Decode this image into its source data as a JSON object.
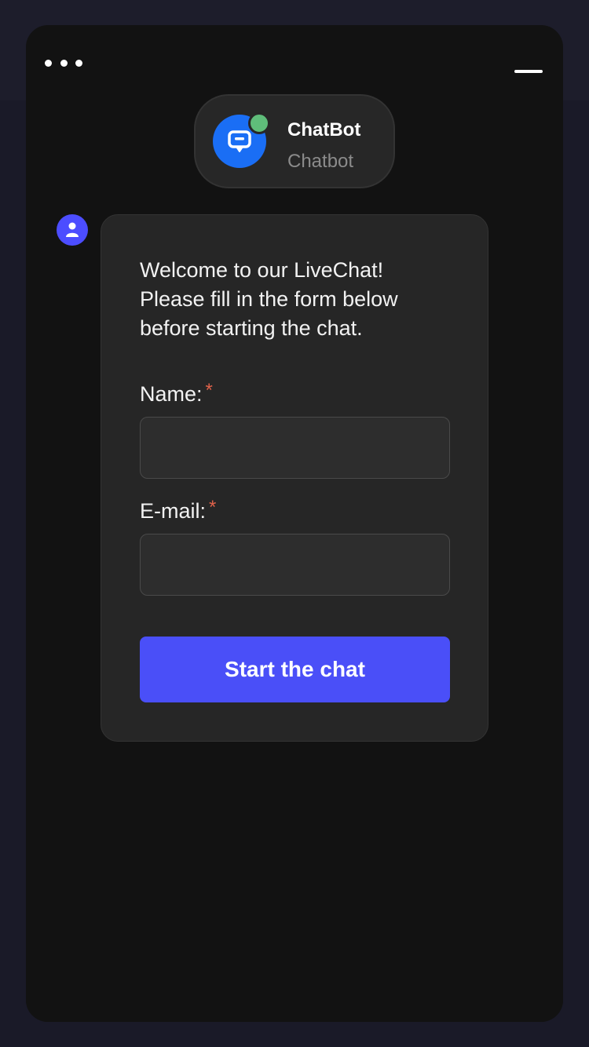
{
  "header": {
    "bot_name": "ChatBot",
    "bot_subtitle": "Chatbot",
    "status": "online",
    "status_color": "#5fbd7a",
    "avatar_icon": "chat-bubble-icon",
    "menu_icon": "more-dots-icon",
    "minimize_icon": "minimize-icon"
  },
  "message": {
    "sender_icon": "user-icon",
    "welcome_lines": [
      "Welcome to our LiveChat!",
      "Please fill in the form below",
      "before starting the chat."
    ]
  },
  "form": {
    "name_label": "Name:",
    "name_value": "",
    "email_label": "E-mail:",
    "email_value": "",
    "required_mark": "*",
    "submit_label": "Start the chat"
  },
  "colors": {
    "accent": "#4a4ff8",
    "bot_avatar": "#1a6ef5",
    "required": "#e0624a"
  }
}
